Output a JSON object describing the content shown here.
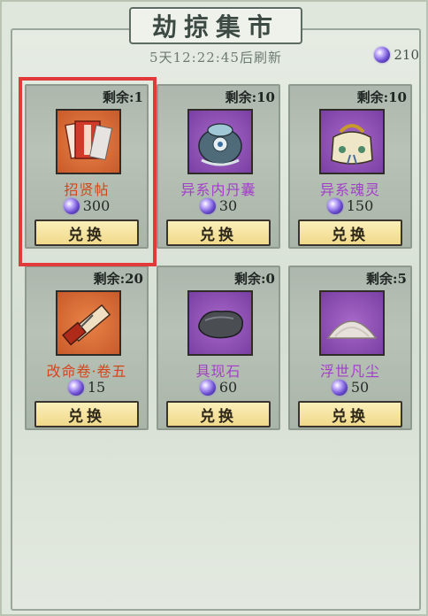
{
  "title": "劫掠集市",
  "refresh_text": "5天12:22:45后刷新",
  "currency": {
    "amount": "210",
    "icon": "soul-jade-icon"
  },
  "buy_label": "兑换",
  "items": [
    {
      "stock": "剩余:1",
      "name": "招贤帖",
      "price": "300",
      "rarity_color": "#d1481d",
      "icon": "recruit-letter-icon"
    },
    {
      "stock": "剩余:10",
      "name": "异系内丹囊",
      "price": "30",
      "rarity_color": "#a23ec9",
      "icon": "inner-pill-pouch-icon"
    },
    {
      "stock": "剩余:10",
      "name": "异系魂灵",
      "price": "150",
      "rarity_color": "#a23ec9",
      "icon": "soul-bag-icon"
    },
    {
      "stock": "剩余:20",
      "name": "改命卷·卷五",
      "price": "15",
      "rarity_color": "#d1481d",
      "icon": "fate-scroll-icon"
    },
    {
      "stock": "剩余:0",
      "name": "具现石",
      "price": "60",
      "rarity_color": "#a23ec9",
      "icon": "stone-icon"
    },
    {
      "stock": "剩余:5",
      "name": "浮世凡尘",
      "price": "50",
      "rarity_color": "#a23ec9",
      "icon": "dust-pile-icon"
    }
  ]
}
